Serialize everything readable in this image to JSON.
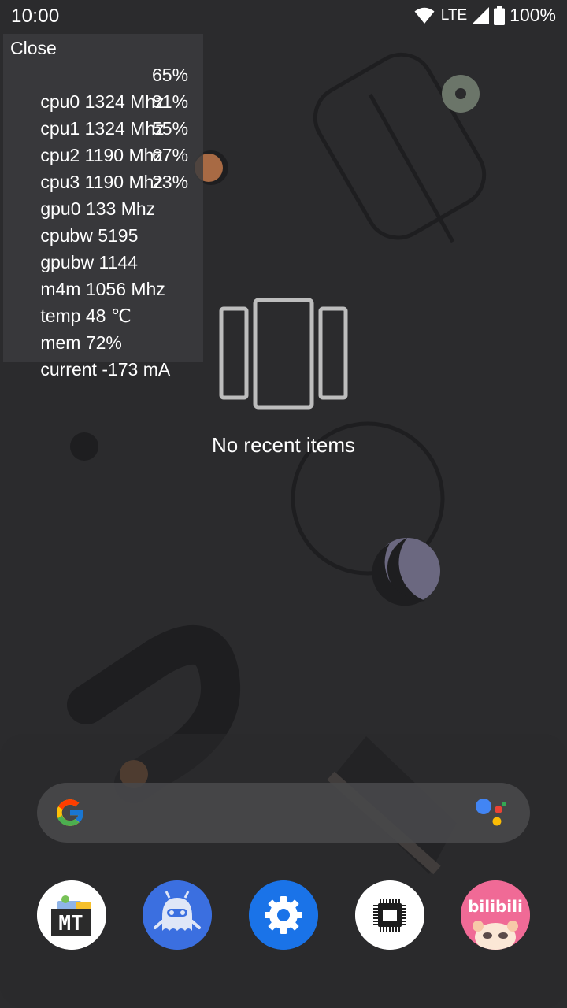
{
  "status_bar": {
    "time": "10:00",
    "network": "LTE",
    "battery": "100%",
    "icons": [
      "wifi-icon",
      "signal-icon",
      "battery-icon"
    ]
  },
  "monitor": {
    "close_label": "Close",
    "rows": [
      {
        "label": "cpu0 1324 Mhz",
        "pct": "65%"
      },
      {
        "label": "cpu1 1324 Mhz",
        "pct": "81%"
      },
      {
        "label": "cpu2 1190 Mhz",
        "pct": "55%"
      },
      {
        "label": "cpu3 1190 Mhz",
        "pct": "67%"
      },
      {
        "label": "gpu0 133 Mhz",
        "pct": "23%"
      },
      {
        "label": "cpubw 5195",
        "pct": ""
      },
      {
        "label": "gpubw 1144",
        "pct": ""
      },
      {
        "label": "m4m 1056 Mhz",
        "pct": ""
      },
      {
        "label": "temp 48 ℃",
        "pct": ""
      },
      {
        "label": "mem 72%",
        "pct": ""
      },
      {
        "label": "current -173 mA",
        "pct": ""
      }
    ]
  },
  "recents": {
    "empty_text": "No recent items"
  },
  "search": {
    "icons": [
      "google-g-icon",
      "assistant-icon"
    ]
  },
  "dock": {
    "apps": [
      {
        "name": "MT Manager",
        "icon": "mt-manager-icon",
        "text": "MT"
      },
      {
        "name": "App Ops",
        "icon": "android-ghost-icon"
      },
      {
        "name": "Settings",
        "icon": "gear-icon"
      },
      {
        "name": "Device Info",
        "icon": "chip-icon"
      },
      {
        "name": "bilibili",
        "icon": "bilibili-icon",
        "text": "bilibili"
      }
    ]
  },
  "colors": {
    "background": "#2b2b2d",
    "overlay": "#3c3c3e",
    "search_bar": "#48484a",
    "settings_blue": "#1a73e8",
    "ghost_blue": "#3367d6",
    "bilibili_pink": "#f06a96"
  }
}
